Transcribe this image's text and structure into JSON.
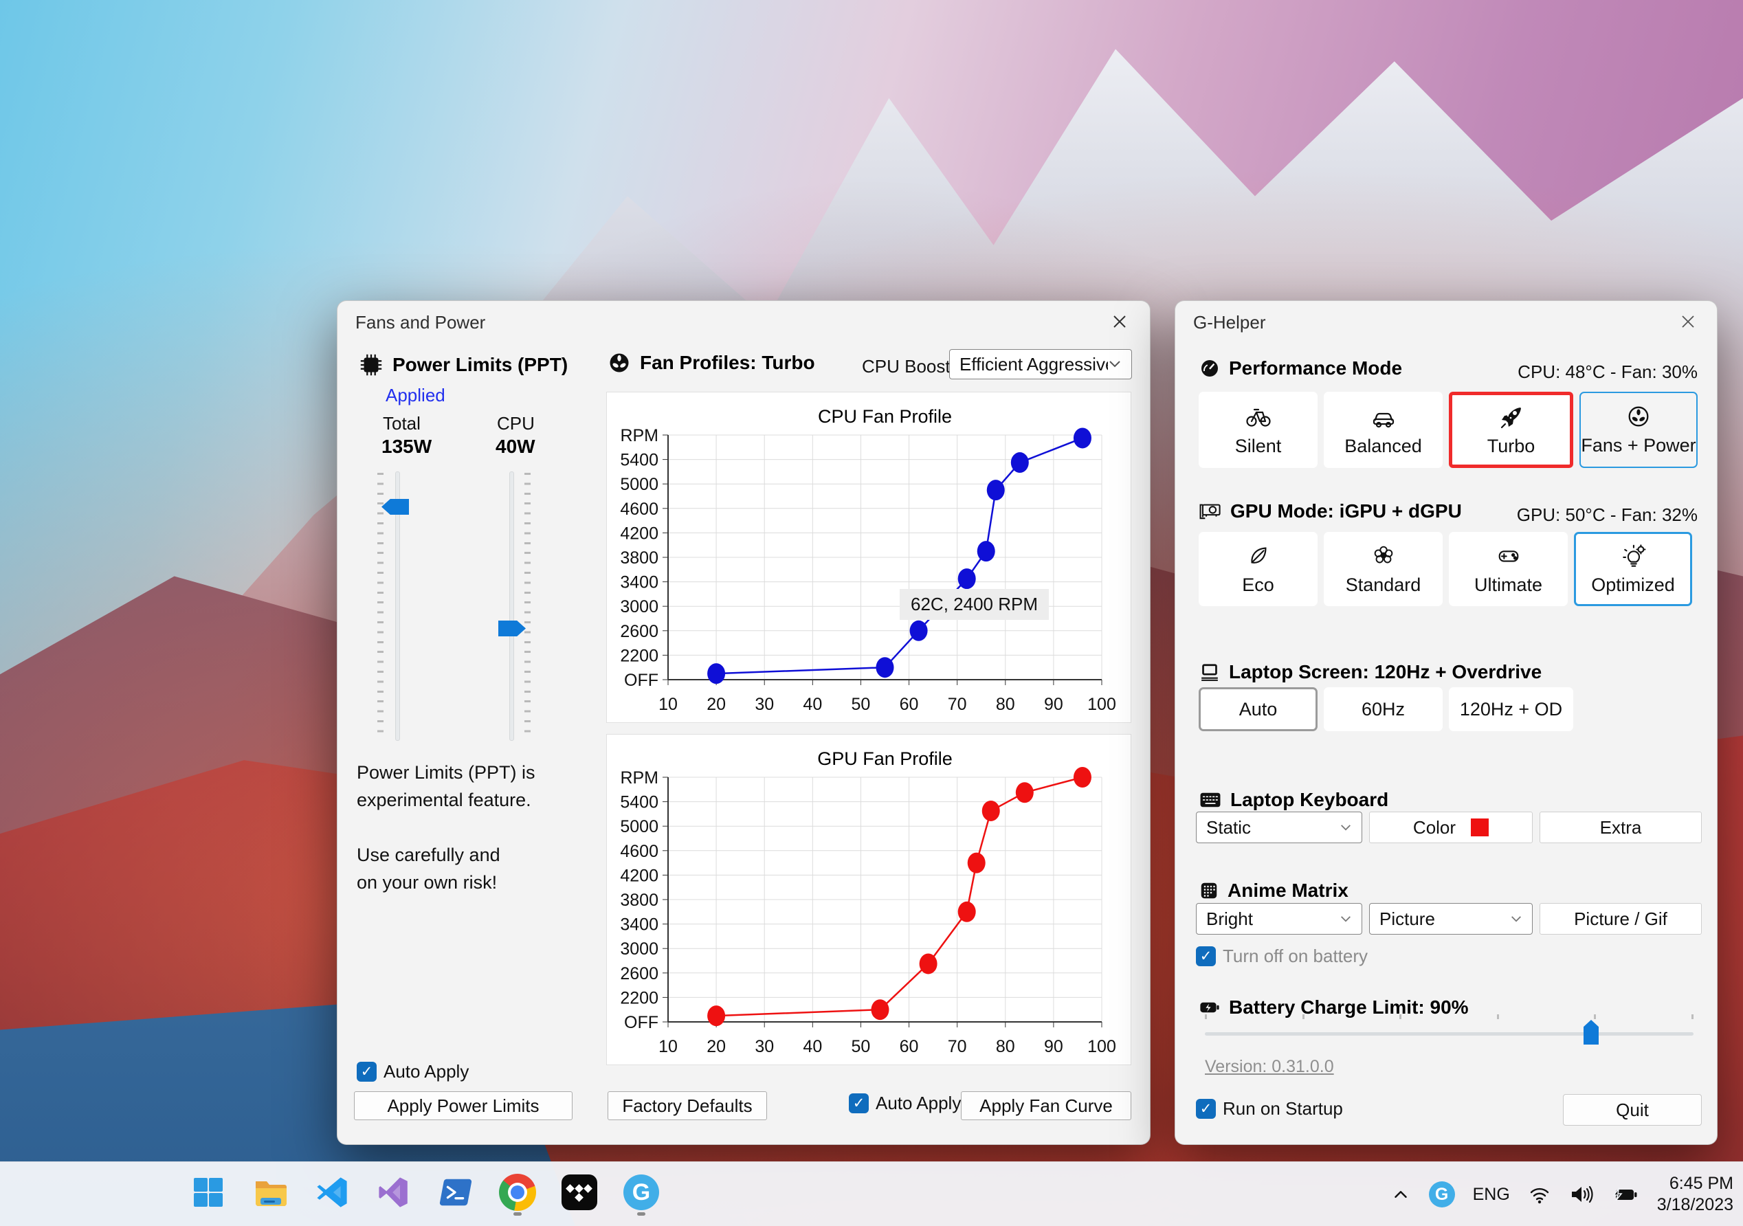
{
  "colors": {
    "accent_blue": "#0f7ad8",
    "selected_red_border": "#f02b2b",
    "selected_blue_border": "#2b9ae0",
    "applied_text": "#2230ee",
    "cpu_series": "#0f0fd6",
    "gpu_series": "#ee1111",
    "keyboard_color_swatch": "#ee1111"
  },
  "fans_window": {
    "title": "Fans and Power",
    "power_limits": {
      "header": "Power Limits (PPT)",
      "status": "Applied",
      "total_label": "Total",
      "total_value": "135W",
      "cpu_label": "CPU",
      "cpu_value": "40W",
      "note1": "Power Limits (PPT) is",
      "note2": "experimental feature.",
      "note3": "Use carefully and",
      "note4": "on your own risk!",
      "auto_apply_label": "Auto Apply",
      "apply_button": "Apply Power Limits"
    },
    "fan_profiles": {
      "header": "Fan Profiles: Turbo",
      "cpu_boost_label": "CPU Boost",
      "cpu_boost_value": "Efficient Aggressive",
      "tooltip": "62C, 2400 RPM",
      "factory_defaults_button": "Factory Defaults",
      "auto_apply_label": "Auto Apply",
      "apply_button": "Apply Fan Curve"
    }
  },
  "chart_data": [
    {
      "type": "line",
      "title": "CPU Fan Profile",
      "color": "#0f0fd6",
      "x_ticks": [
        10,
        20,
        30,
        40,
        50,
        60,
        70,
        80,
        90,
        100
      ],
      "y_tick_labels": [
        "RPM",
        "5400",
        "5000",
        "4600",
        "4200",
        "3800",
        "3400",
        "3000",
        "2600",
        "2200",
        "OFF"
      ],
      "y_value_range": [
        1800,
        5800
      ],
      "x_range": [
        10,
        100
      ],
      "points": [
        [
          20,
          1900
        ],
        [
          55,
          2000
        ],
        [
          62,
          2600
        ],
        [
          72,
          3450
        ],
        [
          76,
          3900
        ],
        [
          78,
          4900
        ],
        [
          83,
          5350
        ],
        [
          96,
          5750
        ]
      ],
      "annotation": "62C, 2400 RPM",
      "grid": true,
      "legend": "none"
    },
    {
      "type": "line",
      "title": "GPU Fan Profile",
      "color": "#ee1111",
      "x_ticks": [
        10,
        20,
        30,
        40,
        50,
        60,
        70,
        80,
        90,
        100
      ],
      "y_tick_labels": [
        "RPM",
        "5400",
        "5000",
        "4600",
        "4200",
        "3800",
        "3400",
        "3000",
        "2600",
        "2200",
        "OFF"
      ],
      "y_value_range": [
        1800,
        5800
      ],
      "x_range": [
        10,
        100
      ],
      "points": [
        [
          20,
          1900
        ],
        [
          54,
          2000
        ],
        [
          64,
          2750
        ],
        [
          72,
          3600
        ],
        [
          74,
          4400
        ],
        [
          77,
          5250
        ],
        [
          84,
          5550
        ],
        [
          96,
          5800
        ]
      ],
      "grid": true,
      "legend": "none"
    }
  ],
  "ghelper_window": {
    "title": "G-Helper",
    "performance": {
      "header": "Performance Mode",
      "status": "CPU: 48°C -  Fan: 30%",
      "buttons": [
        {
          "label": "Silent",
          "icon": "bicycle-icon"
        },
        {
          "label": "Balanced",
          "icon": "car-icon"
        },
        {
          "label": "Turbo",
          "icon": "rocket-icon",
          "selected": "red"
        },
        {
          "label": "Fans + Power",
          "icon": "fan-icon",
          "selected": "blue"
        }
      ]
    },
    "gpu": {
      "header": "GPU Mode: iGPU + dGPU",
      "status": "GPU: 50°C -  Fan: 32%",
      "buttons": [
        {
          "label": "Eco",
          "icon": "leaf-icon"
        },
        {
          "label": "Standard",
          "icon": "flower-icon"
        },
        {
          "label": "Ultimate",
          "icon": "gamepad-icon"
        },
        {
          "label": "Optimized",
          "icon": "bulb-gear-icon",
          "selected": "blue"
        }
      ]
    },
    "screen": {
      "header": "Laptop Screen: 120Hz + Overdrive",
      "buttons": [
        {
          "label": "Auto",
          "selected": "gray"
        },
        {
          "label": "60Hz"
        },
        {
          "label": "120Hz + OD"
        }
      ]
    },
    "keyboard": {
      "header": "Laptop Keyboard",
      "mode_value": "Static",
      "color_button": "Color",
      "extra_button": "Extra"
    },
    "anime": {
      "header": "Anime Matrix",
      "brightness_value": "Bright",
      "mode_value": "Picture",
      "picture_button": "Picture / Gif",
      "battery_checkbox_label": "Turn off on battery"
    },
    "battery": {
      "header": "Battery Charge Limit: 90%"
    },
    "version": "Version: 0.31.0.0",
    "startup_checkbox_label": "Run on Startup",
    "quit_button": "Quit"
  },
  "taskbar": {
    "icons": [
      "start",
      "file-explorer",
      "vscode",
      "visual-studio",
      "powershell",
      "chrome",
      "tidal",
      "g-helper"
    ],
    "running_indicators": [
      "chrome",
      "g-helper"
    ],
    "tray": {
      "language": "ENG",
      "time": "6:45 PM",
      "date": "3/18/2023",
      "icons": [
        "chevron-up",
        "g-helper-tray",
        "wifi",
        "volume",
        "battery"
      ]
    }
  }
}
